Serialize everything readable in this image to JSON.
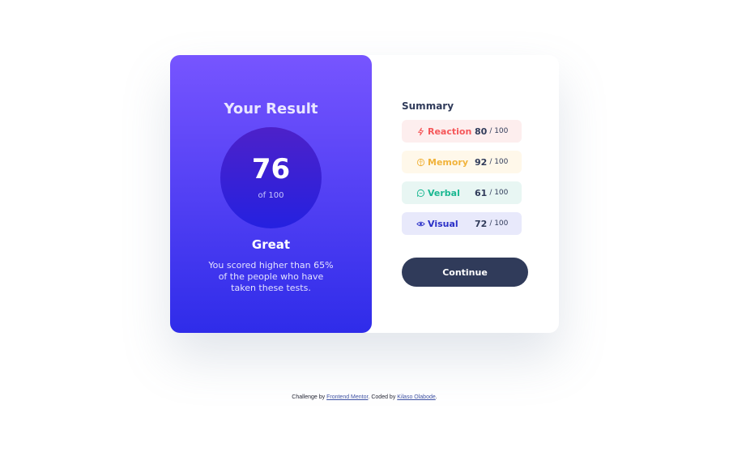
{
  "result": {
    "title": "Your Result",
    "score": "76",
    "of_label": "of 100",
    "grade": "Great",
    "description": "You scored higher than 65% of the people who have taken these tests."
  },
  "summary": {
    "title": "Summary",
    "items": [
      {
        "category": "Reaction",
        "score": "80",
        "max": "/ 100",
        "icon": "lightning-icon",
        "color": "#f5585a"
      },
      {
        "category": "Memory",
        "score": "92",
        "max": "/ 100",
        "icon": "brain-icon",
        "color": "#f1b33c"
      },
      {
        "category": "Verbal",
        "score": "61",
        "max": "/ 100",
        "icon": "chat-bubble-icon",
        "color": "#1bb892"
      },
      {
        "category": "Visual",
        "score": "72",
        "max": "/ 100",
        "icon": "eye-icon",
        "color": "#2a2fc7"
      }
    ],
    "continue_label": "Continue"
  },
  "attribution": {
    "prefix": "Challenge by",
    "link1": "Frontend Mentor",
    "middle": ". Coded by",
    "link2": "Kilaso Olabode",
    "suffix": "."
  },
  "colors": {
    "accent_start": "#7755ff",
    "accent_end": "#2f2ce9",
    "button": "#303b5a"
  }
}
